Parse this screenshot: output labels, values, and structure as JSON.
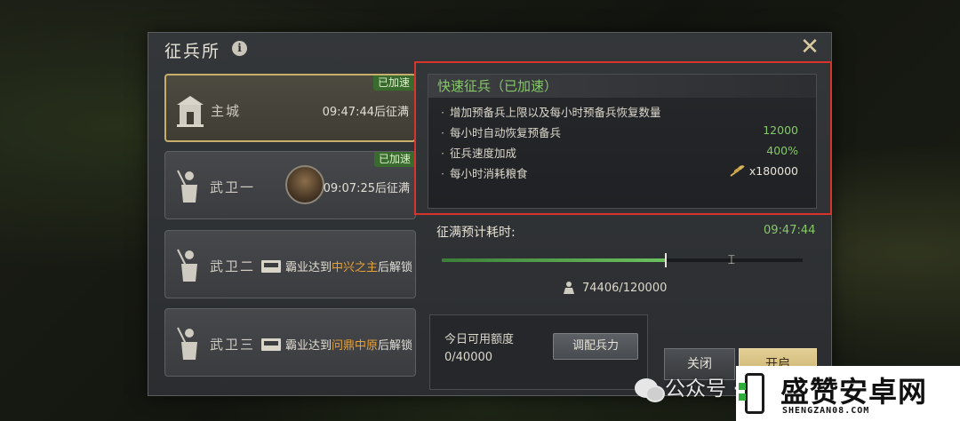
{
  "dialog": {
    "title": "征兵所",
    "info_icon": "i",
    "close_icon": "✕"
  },
  "slots": [
    {
      "name": "主城",
      "status": "09:47:44后征满",
      "badge": "已加速",
      "active": true
    },
    {
      "name": "武卫一",
      "status": "09:07:25后征满",
      "badge": "已加速",
      "active": false
    },
    {
      "name": "武卫二",
      "unlock_prefix": "霸业达到",
      "unlock_target": "中兴之主",
      "unlock_suffix": "后解锁"
    },
    {
      "name": "武卫三",
      "unlock_prefix": "霸业达到",
      "unlock_target": "问鼎中原",
      "unlock_suffix": "后解锁"
    }
  ],
  "quick": {
    "header": "快速征兵（已加速）",
    "bullet": "·",
    "rows": [
      {
        "label": "增加预备兵上限以及每小时预备兵恢复数量",
        "value": ""
      },
      {
        "label": "每小时自动恢复预备兵",
        "value": "12000"
      },
      {
        "label": "征兵速度加成",
        "value": "400%"
      },
      {
        "label": "每小时消耗粮食",
        "value": "x180000"
      }
    ]
  },
  "progress": {
    "label": "征满预计耗时:",
    "time": "09:47:44",
    "troops_current": 74406,
    "troops_max": 120000,
    "troops_text": "74406/120000"
  },
  "quota": {
    "label": "今日可用额度",
    "value": "0/40000",
    "allocate_label": "调配兵力"
  },
  "buttons": {
    "close_label": "关闭",
    "open_label": "开启"
  },
  "watermark": {
    "wechat_text": "公众号 ·",
    "brand_name": "盛赞安卓网",
    "brand_sub": "SHENGZAN08.COM"
  },
  "colors": {
    "accent_green": "#86c86a",
    "highlight_red": "#d7342c",
    "gold": "#c7ae6b",
    "unlock_orange": "#e8a23a"
  }
}
